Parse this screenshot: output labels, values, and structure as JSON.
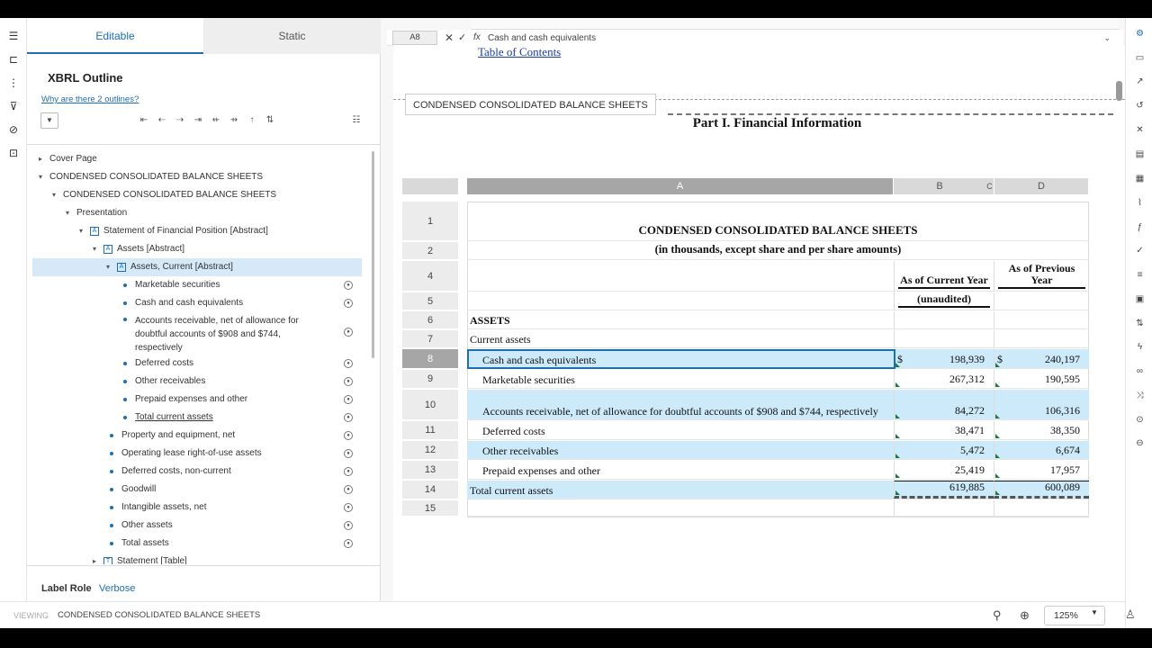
{
  "tabs": {
    "editable": "Editable",
    "static": "Static"
  },
  "outline": {
    "title": "XBRL Outline",
    "why_link": "Why are there 2 outlines?",
    "label_role": "Label Role",
    "label_role_value": "Verbose",
    "nodes": [
      {
        "label": "Cover Page",
        "indent": 0,
        "caret": "▸",
        "icon": "",
        "eye": false
      },
      {
        "label": "CONDENSED CONSOLIDATED BALANCE SHEETS",
        "indent": 0,
        "caret": "▾",
        "icon": "",
        "eye": false
      },
      {
        "label": "CONDENSED CONSOLIDATED BALANCE SHEETS",
        "indent": 1,
        "caret": "▾",
        "icon": "",
        "eye": false
      },
      {
        "label": "Presentation",
        "indent": 2,
        "caret": "▾",
        "icon": "",
        "eye": false
      },
      {
        "label": "Statement of Financial Position [Abstract]",
        "indent": 3,
        "caret": "▾",
        "icon": "A",
        "eye": false
      },
      {
        "label": "Assets [Abstract]",
        "indent": 4,
        "caret": "▾",
        "icon": "A",
        "eye": false
      },
      {
        "label": "Assets, Current [Abstract]",
        "indent": 5,
        "caret": "▾",
        "icon": "A",
        "eye": false,
        "selected": true
      },
      {
        "label": "Marketable securities",
        "indent": 6,
        "caret": "",
        "icon": "dot",
        "eye": true
      },
      {
        "label": "Cash and cash equivalents",
        "indent": 6,
        "caret": "",
        "icon": "dot",
        "eye": true
      },
      {
        "label": "Accounts receivable, net of allowance for doubtful accounts of $908 and $744, respectively",
        "indent": 6,
        "caret": "",
        "icon": "dot",
        "eye": true,
        "multi": true
      },
      {
        "label": "Deferred costs",
        "indent": 6,
        "caret": "",
        "icon": "dot",
        "eye": true
      },
      {
        "label": "Other receivables",
        "indent": 6,
        "caret": "",
        "icon": "dot",
        "eye": true
      },
      {
        "label": "Prepaid expenses and other",
        "indent": 6,
        "caret": "",
        "icon": "dot",
        "eye": true
      },
      {
        "label": "Total current assets",
        "indent": 6,
        "caret": "",
        "icon": "dot",
        "eye": true,
        "underline": true
      },
      {
        "label": "Property and equipment, net",
        "indent": 5,
        "caret": "",
        "icon": "dot",
        "eye": true
      },
      {
        "label": "Operating lease right-of-use assets",
        "indent": 5,
        "caret": "",
        "icon": "dot",
        "eye": true
      },
      {
        "label": "Deferred costs, non-current",
        "indent": 5,
        "caret": "",
        "icon": "dot",
        "eye": true
      },
      {
        "label": "Goodwill",
        "indent": 5,
        "caret": "",
        "icon": "dot",
        "eye": true
      },
      {
        "label": "Intangible assets, net",
        "indent": 5,
        "caret": "",
        "icon": "dot",
        "eye": true
      },
      {
        "label": "Other assets",
        "indent": 5,
        "caret": "",
        "icon": "dot",
        "eye": true
      },
      {
        "label": "Total assets",
        "indent": 5,
        "caret": "",
        "icon": "dot",
        "eye": true
      },
      {
        "label": "Statement [Table]",
        "indent": 4,
        "caret": "▸",
        "icon": "T",
        "eye": false
      }
    ]
  },
  "formula_bar": {
    "cell_ref": "A8",
    "value": "Cash and cash equivalents"
  },
  "document": {
    "toc_link": "Table of Contents",
    "sheet_tab": "CONDENSED CONSOLIDATED BALANCE SHEETS",
    "part_title": "Part I. Financial Information",
    "columns": {
      "a": "A",
      "b": "B",
      "c": "C",
      "d": "D"
    },
    "rows": [
      {
        "n": "1",
        "kind": "title",
        "a": "CONDENSED CONSOLIDATED BALANCE SHEETS",
        "h": 44
      },
      {
        "n": "2",
        "kind": "subtitle",
        "a": "(in thousands, except share and per share amounts)",
        "h": 20
      },
      {
        "n": "4",
        "kind": "head",
        "b": "As of Current Year",
        "d": "As of Previous Year",
        "h": 34
      },
      {
        "n": "5",
        "kind": "head2",
        "b": "(unaudited)",
        "h": 20
      },
      {
        "n": "6",
        "kind": "label",
        "a": "ASSETS",
        "h": 20
      },
      {
        "n": "7",
        "kind": "label",
        "a": "Current assets",
        "h": 20
      },
      {
        "n": "8",
        "kind": "data",
        "a": "Cash and cash equivalents",
        "b": "198,939",
        "d": "240,197",
        "cur": "$",
        "hl": true,
        "sel": true,
        "h": 22
      },
      {
        "n": "9",
        "kind": "data",
        "a": "Marketable securities",
        "b": "267,312",
        "d": "190,595",
        "h": 21
      },
      {
        "n": "10",
        "kind": "data",
        "a": "Accounts receivable, net of allowance for doubtful accounts of $908 and $744, respectively",
        "b": "84,272",
        "d": "106,316",
        "hl": true,
        "h": 34
      },
      {
        "n": "11",
        "kind": "data",
        "a": "Deferred costs",
        "b": "38,471",
        "d": "38,350",
        "h": 21
      },
      {
        "n": "12",
        "kind": "data",
        "a": "Other receivables",
        "b": "5,472",
        "d": "6,674",
        "hl": true,
        "h": 21
      },
      {
        "n": "13",
        "kind": "data",
        "a": "Prepaid expenses and other",
        "b": "25,419",
        "d": "17,957",
        "h": 21
      },
      {
        "n": "14",
        "kind": "total",
        "a": "Total current assets",
        "b": "619,885",
        "d": "600,089",
        "hl": true,
        "h": 21
      },
      {
        "n": "15",
        "kind": "blank",
        "h": 18
      }
    ]
  },
  "status_bar": {
    "label": "VIEWING",
    "value": "CONDENSED CONSOLIDATED BALANCE SHEETS"
  },
  "zoom": {
    "level": "125%"
  }
}
